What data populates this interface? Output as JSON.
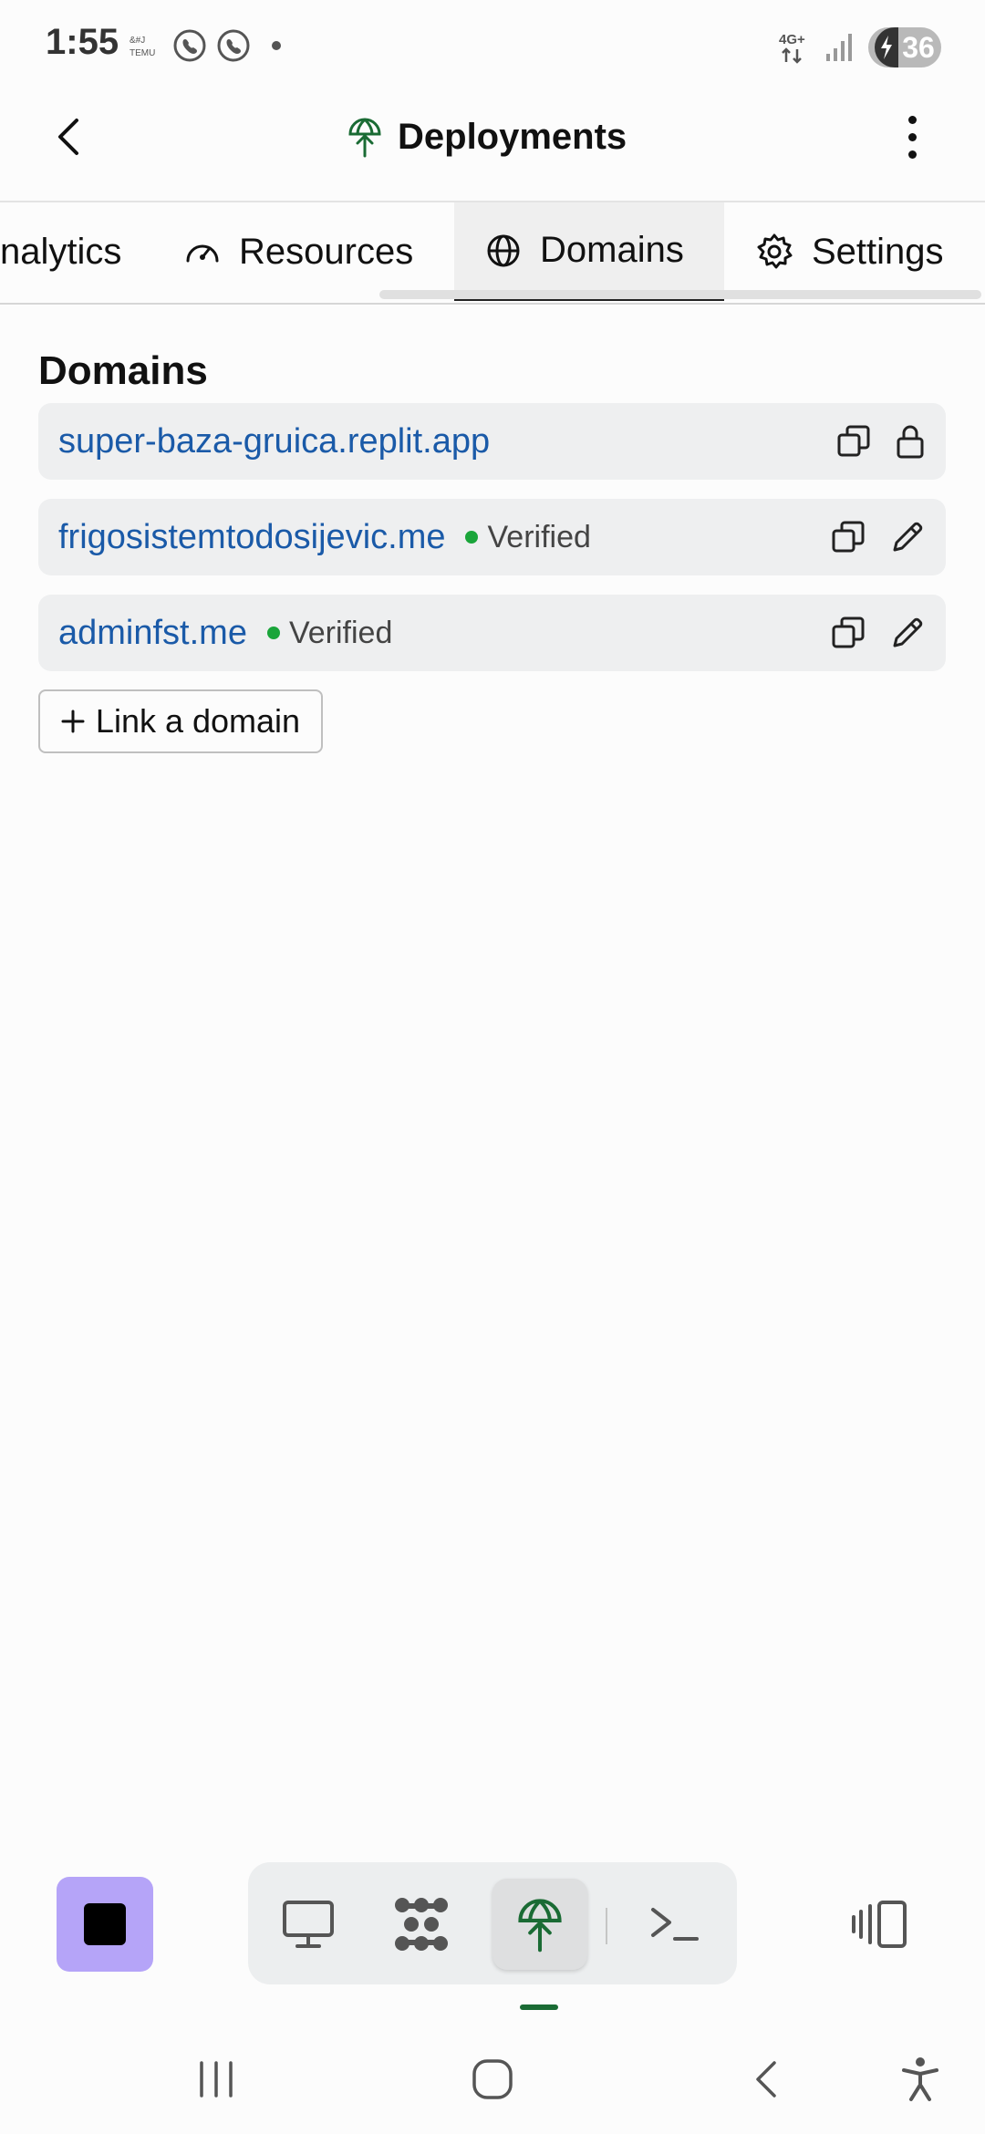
{
  "status_bar": {
    "time": "1:55",
    "notification_icons": [
      "temu-icon",
      "viber-icon",
      "viber-icon"
    ],
    "network": "4G+",
    "battery": "36"
  },
  "header": {
    "title": "Deployments",
    "back_icon": "chevron-left-icon",
    "title_icon": "deployments-icon",
    "menu_icon": "kebab-menu-icon"
  },
  "tabs": [
    {
      "label": "nalytics",
      "icon": "analytics-icon",
      "active": false
    },
    {
      "label": "Resources",
      "icon": "gauge-icon",
      "active": false
    },
    {
      "label": "Domains",
      "icon": "globe-icon",
      "active": true
    },
    {
      "label": "Settings",
      "icon": "gear-icon",
      "active": false
    }
  ],
  "content": {
    "section_title": "Domains",
    "domains": [
      {
        "name": "super-baza-gruica.replit.app",
        "status": "",
        "action_icons": [
          "copy-icon",
          "lock-icon"
        ]
      },
      {
        "name": "frigosistemtodosijevic.me",
        "status": "Verified",
        "action_icons": [
          "copy-icon",
          "pencil-icon"
        ]
      },
      {
        "name": "adminfst.me",
        "status": "Verified",
        "action_icons": [
          "copy-icon",
          "pencil-icon"
        ]
      }
    ],
    "link_domain_label": "Link a domain",
    "link_domain_icon": "plus-icon"
  },
  "colors": {
    "link": "#1a5aa8",
    "verified_dot": "#1aa53a",
    "stop_button": "#b5a4f8",
    "deploy_icon": "#1a6b34"
  },
  "bottom_toolbar": {
    "stop_icon": "stop-icon",
    "dock_icons": [
      "desktop-icon",
      "nodes-icon",
      "deployments-icon",
      "terminal-icon"
    ],
    "active_dock": "deployments-icon",
    "layout_icon": "layout-toggle-icon"
  },
  "nav_bar": [
    "recents-icon",
    "home-icon",
    "back-icon",
    "accessibility-icon"
  ]
}
